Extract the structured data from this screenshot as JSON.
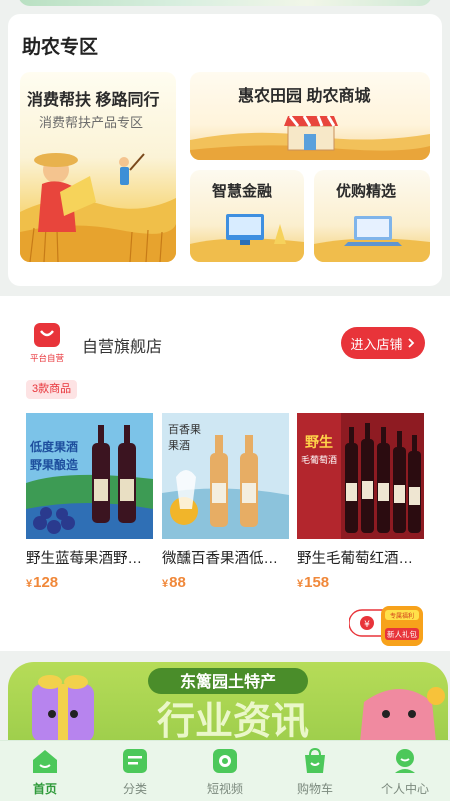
{
  "farm_section": {
    "title": "助农专区",
    "tiles": [
      {
        "title": "消费帮扶 移路同行",
        "subtitle": "消费帮扶产品专区"
      },
      {
        "title": "惠农田园 助农商城"
      },
      {
        "title": "智慧金融"
      },
      {
        "title": "优购精选"
      }
    ]
  },
  "store": {
    "logo_text": "平台自营",
    "name": "自营旗舰店",
    "enter_label": "进入店铺",
    "count_badge": "3款商品",
    "products": [
      {
        "name": "野生蓝莓果酒野生蓝莓果酒",
        "price": "128",
        "currency": "¥",
        "img_text": [
          "低度果酒",
          "野果酿造"
        ]
      },
      {
        "name": "微醺百香果酒低度果酒",
        "price": "88",
        "currency": "¥",
        "img_text": [
          "百香果",
          "果酒"
        ]
      },
      {
        "name": "野生毛葡萄红酒野生毛葡萄",
        "price": "158",
        "currency": "¥",
        "img_text": [
          "野生",
          "毛葡萄酒"
        ]
      }
    ]
  },
  "gift_float": {
    "label": "新人礼包",
    "tag": "专属福利"
  },
  "banner": {
    "top_text": "东篱园土特产",
    "main_text": "行业资讯"
  },
  "tabbar": [
    {
      "label": "首页",
      "icon": "home-icon",
      "active": true
    },
    {
      "label": "分类",
      "icon": "category-icon",
      "active": false
    },
    {
      "label": "短视频",
      "icon": "video-icon",
      "active": false
    },
    {
      "label": "购物车",
      "icon": "cart-icon",
      "active": false
    },
    {
      "label": "个人中心",
      "icon": "profile-icon",
      "active": false
    }
  ],
  "colors": {
    "accent_red": "#e8343a",
    "price_orange": "#f0883a",
    "tab_active": "#2f9a3a",
    "tab_green": "#4cc85a"
  }
}
